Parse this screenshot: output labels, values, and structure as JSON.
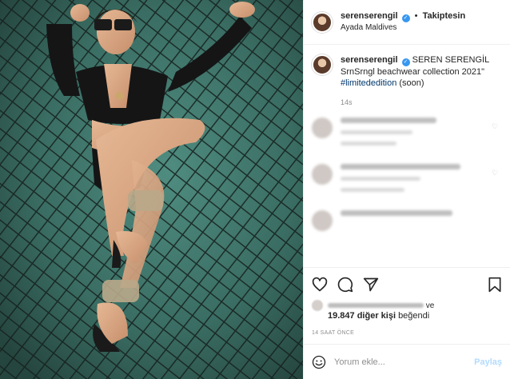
{
  "post": {
    "header": {
      "username": "serenserengil",
      "follow_label": "Takiptesin",
      "location": "Ayada Maldives"
    },
    "caption": {
      "username": "serenserengil",
      "display_name": "SEREN SERENGİL",
      "line1": "SrnSrngl beachwear collection 2021\"",
      "hashtag": "#limitededition",
      "line3": " (soon)",
      "age": "14s"
    },
    "likes": {
      "suffix": "ve",
      "count_text": "19.847 diğer kişi",
      "verb": "beğendi"
    },
    "timestamp": "14 SAAT ÖNCE",
    "comment_input": {
      "placeholder": "Yorum ekle..."
    },
    "post_button": "Paylaş"
  },
  "icons": [
    "verified-icon",
    "heart-icon",
    "comment-icon",
    "share-icon",
    "bookmark-icon",
    "emoji-icon"
  ],
  "colors": {
    "link": "#00376b",
    "verified": "#3897f0",
    "muted": "#8e8e8e",
    "post_button": "#b3dbff"
  }
}
